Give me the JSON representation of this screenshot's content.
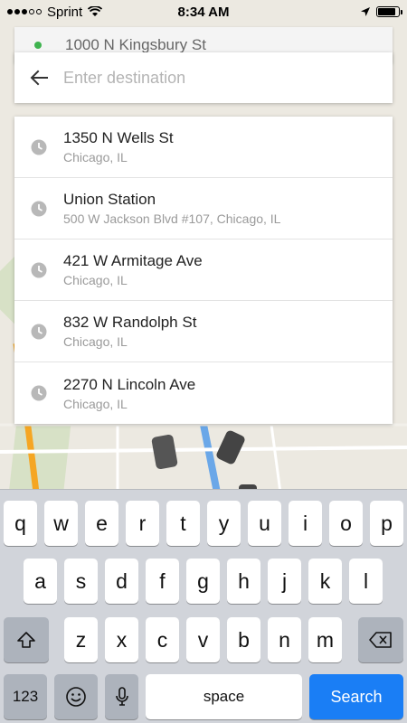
{
  "status_bar": {
    "carrier": "Sprint",
    "time": "8:34 AM",
    "signal_bars": 3,
    "signal_total": 5,
    "battery_level": 0.85
  },
  "pickup": {
    "address": "1000 N Kingsbury St"
  },
  "destination": {
    "placeholder": "Enter destination",
    "value": ""
  },
  "suggestions": [
    {
      "title": "1350 N Wells St",
      "subtitle": "Chicago, IL"
    },
    {
      "title": "Union Station",
      "subtitle": "500 W Jackson Blvd #107, Chicago, IL"
    },
    {
      "title": "421 W Armitage Ave",
      "subtitle": "Chicago, IL"
    },
    {
      "title": "832 W Randolph St",
      "subtitle": "Chicago, IL"
    },
    {
      "title": "2270 N Lincoln Ave",
      "subtitle": "Chicago, IL"
    }
  ],
  "keyboard": {
    "row1": [
      "q",
      "w",
      "e",
      "r",
      "t",
      "y",
      "u",
      "i",
      "o",
      "p"
    ],
    "row2": [
      "a",
      "s",
      "d",
      "f",
      "g",
      "h",
      "j",
      "k",
      "l"
    ],
    "row3": [
      "z",
      "x",
      "c",
      "v",
      "b",
      "n",
      "m"
    ],
    "numbers_label": "123",
    "space_label": "space",
    "search_label": "Search"
  },
  "colors": {
    "accent": "#1a7ef5",
    "pickup_dot": "#3fb34f",
    "cursor": "#1d9bd7",
    "map_road_orange": "#f5a623",
    "map_road_blue": "#6aa7e8"
  }
}
